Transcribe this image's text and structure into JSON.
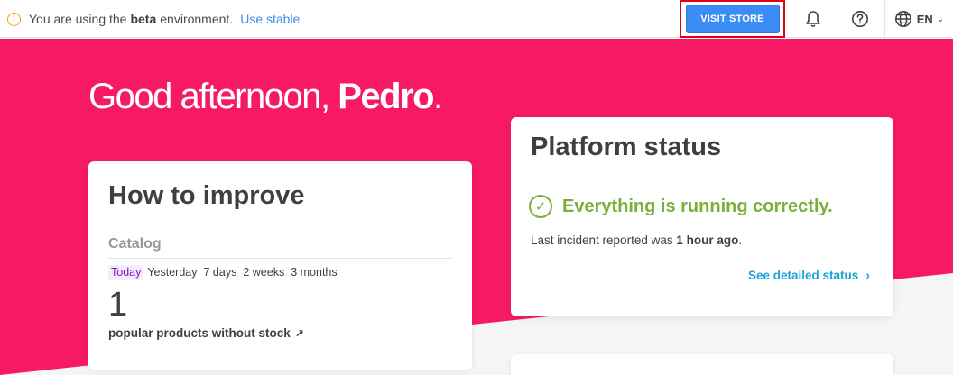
{
  "banner": {
    "prefix": "You are using the",
    "env": "beta",
    "suffix": "environment.",
    "link": "Use stable"
  },
  "header": {
    "visit_store": "VISIT STORE",
    "language": "EN"
  },
  "hero": {
    "greeting": "Good afternoon,",
    "name": "Pedro",
    "punct": "."
  },
  "improve": {
    "title": "How to improve",
    "section": "Catalog",
    "periods": [
      "Today",
      "Yesterday",
      "7 days",
      "2 weeks",
      "3 months"
    ],
    "selected_period": "Today",
    "value": "1",
    "description": "popular products without stock"
  },
  "status": {
    "title": "Platform status",
    "message": "Everything is running correctly.",
    "incident_prefix": "Last incident reported was",
    "incident_time": "1 hour ago",
    "incident_suffix": ".",
    "link": "See detailed status"
  },
  "colors": {
    "brand_pink": "#f71963",
    "primary_blue": "#3c8cf5",
    "success_green": "#79b03a",
    "link_blue": "#1aa3d6",
    "warning": "#f0a300"
  }
}
